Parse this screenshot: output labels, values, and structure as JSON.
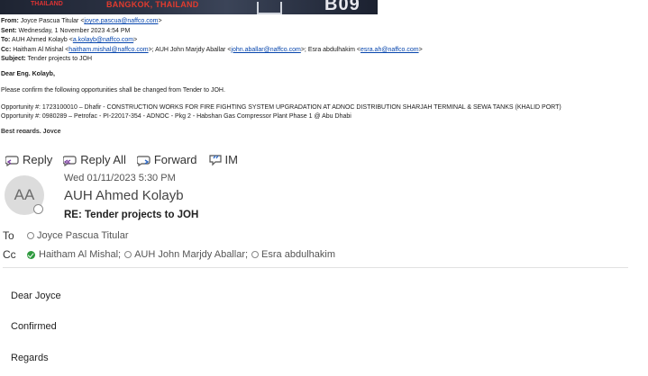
{
  "banner": {
    "left_text": "THAILAND",
    "city": "BANGKOK, THAILAND",
    "number": "B09"
  },
  "quoted": {
    "from_label": "From:",
    "from_name": "Joyce Pascua Titular <",
    "from_email": "joyce.pascua@naffco.com",
    "from_close": ">",
    "sent_label": "Sent:",
    "sent_value": "Wednesday, 1 November 2023 4:54 PM",
    "to_label": "To:",
    "to_name": "AUH Ahmed Kolayb <",
    "to_email": "a.kolayb@naffco.com",
    "to_close": ">",
    "cc_label": "Cc:",
    "cc_1_name": "Haitham Al Mishal <",
    "cc_1_email": "haitham.mishal@naffco.com",
    "cc_2_name": ">; AUH John Marjdy Aballar <",
    "cc_2_email": "john.aballar@naffco.com",
    "cc_3_name": ">; Esra abdulhakim <",
    "cc_3_email": "esra.ah@naffco.com",
    "cc_close": ">",
    "subject_label": "Subject:",
    "subject_value": "Tender projects to JOH",
    "greeting": "Dear Eng. Kolayb,",
    "para1": "Please confirm the following opportunities shall be changed from Tender to JOH.",
    "opp1": "Opportunity #: 1723100010 – Dhafir - CONSTRUCTION WORKS FOR FIRE FIGHTING SYSTEM UPGRADATION AT ADNOC DISTRIBUTION SHARJAH TERMINAL & SEWA TANKS (KHALID PORT)",
    "opp2": "Opportunity #: 0980289 – Petrofac - PI-22017-354 - ADNOC - Pkg 2 - Habshan Gas Compressor Plant Phase 1 @ Abu Dhabi",
    "cut_line": "Best regards, Joyce"
  },
  "actions": {
    "reply": "Reply",
    "reply_all": "Reply All",
    "forward": "Forward",
    "im": "IM"
  },
  "message": {
    "avatar_initials": "AA",
    "date": "Wed 01/11/2023 5:30 PM",
    "sender": "AUH Ahmed Kolayb",
    "subject": "RE: Tender projects to JOH",
    "to_label": "To",
    "to_recipient": "Joyce Pascua Titular",
    "cc_label": "Cc",
    "cc_recipients": [
      "Haitham Al Mishal;",
      "AUH John Marjdy Aballar;",
      "Esra abdulhakim"
    ]
  },
  "body": {
    "line1": "Dear Joyce",
    "line2": "Confirmed",
    "line3": "Regards"
  }
}
